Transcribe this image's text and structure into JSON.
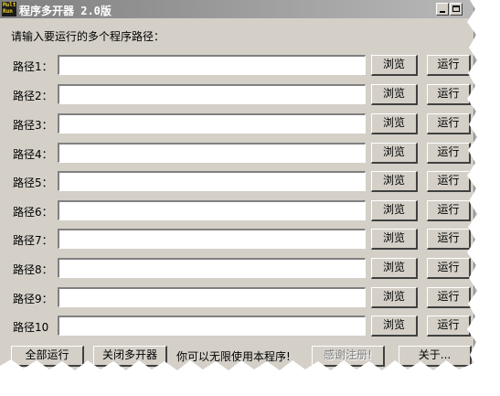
{
  "window": {
    "title": "程序多开器 2.0版",
    "icon_text_line1": "Multi",
    "icon_text_line2": "Run",
    "icon_name": "multirun-app-icon"
  },
  "prompt_label": "请输入要运行的多个程序路径：",
  "rows": [
    {
      "label": "路径1：",
      "value": "",
      "browse_label": "浏览",
      "run_label": "运行"
    },
    {
      "label": "路径2：",
      "value": "",
      "browse_label": "浏览",
      "run_label": "运行"
    },
    {
      "label": "路径3：",
      "value": "",
      "browse_label": "浏览",
      "run_label": "运行"
    },
    {
      "label": "路径4：",
      "value": "",
      "browse_label": "浏览",
      "run_label": "运行"
    },
    {
      "label": "路径5：",
      "value": "",
      "browse_label": "浏览",
      "run_label": "运行"
    },
    {
      "label": "路径6：",
      "value": "",
      "browse_label": "浏览",
      "run_label": "运行"
    },
    {
      "label": "路径7：",
      "value": "",
      "browse_label": "浏览",
      "run_label": "运行"
    },
    {
      "label": "路径8：",
      "value": "",
      "browse_label": "浏览",
      "run_label": "运行"
    },
    {
      "label": "路径9：",
      "value": "",
      "browse_label": "浏览",
      "run_label": "运行"
    },
    {
      "label": "路径10",
      "value": "",
      "browse_label": "浏览",
      "run_label": "运行"
    }
  ],
  "footer": {
    "run_all_label": "全部运行",
    "close_all_label": "关闭多开器",
    "unlimited_text": "你可以无限使用本程序!",
    "register_label": "感谢注册!",
    "about_label": "关于..."
  },
  "colors": {
    "window_bg": "#d4d0c8",
    "titlebar_inactive_start": "#808080",
    "titlebar_inactive_end": "#b8b8b8"
  }
}
